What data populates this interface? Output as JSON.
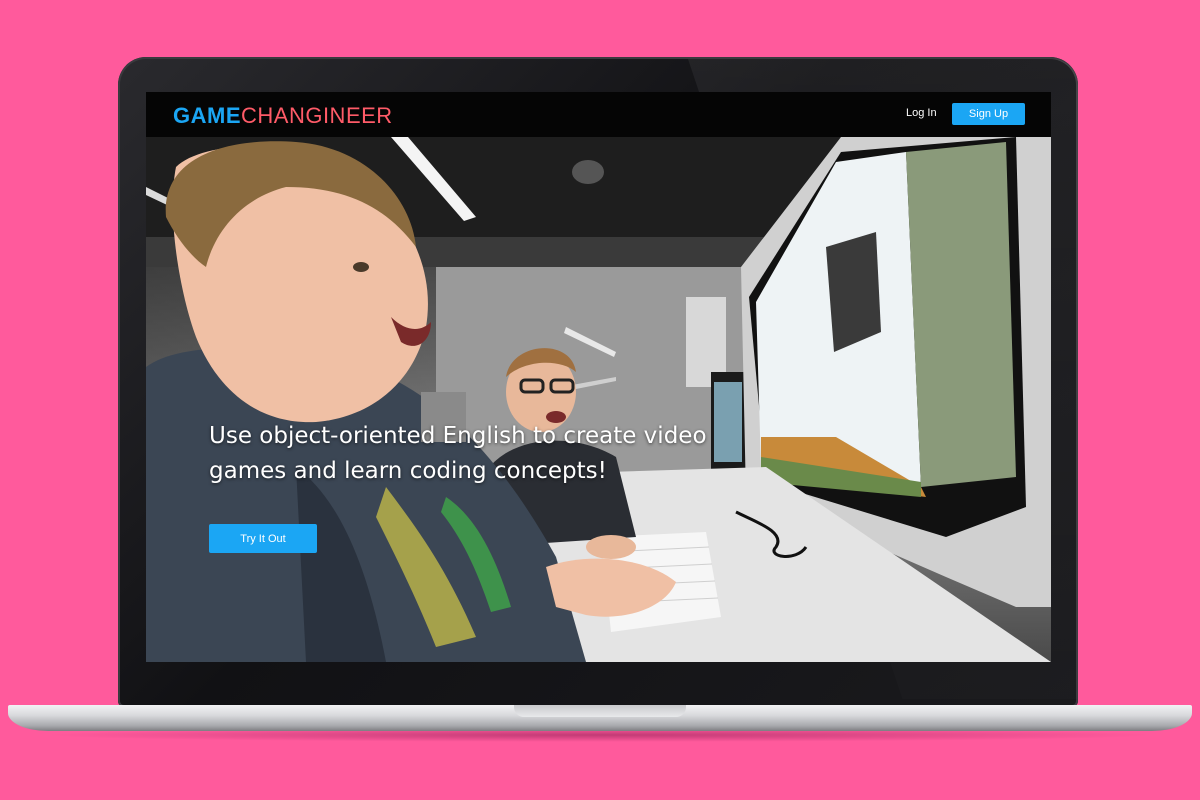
{
  "nav": {
    "logo_part1": "GAME",
    "logo_part2": "CHANGINEER",
    "login_label": "Log In",
    "signup_label": "Sign Up"
  },
  "hero": {
    "headline": "Use object-oriented English to create video games and learn coding concepts!",
    "cta_label": "Try It Out",
    "photo": "kids-coding-at-computers-photo"
  },
  "colors": {
    "background": "#ff5a9c",
    "accent_blue": "#1ba6f4",
    "logo_red": "#ff5b68"
  }
}
